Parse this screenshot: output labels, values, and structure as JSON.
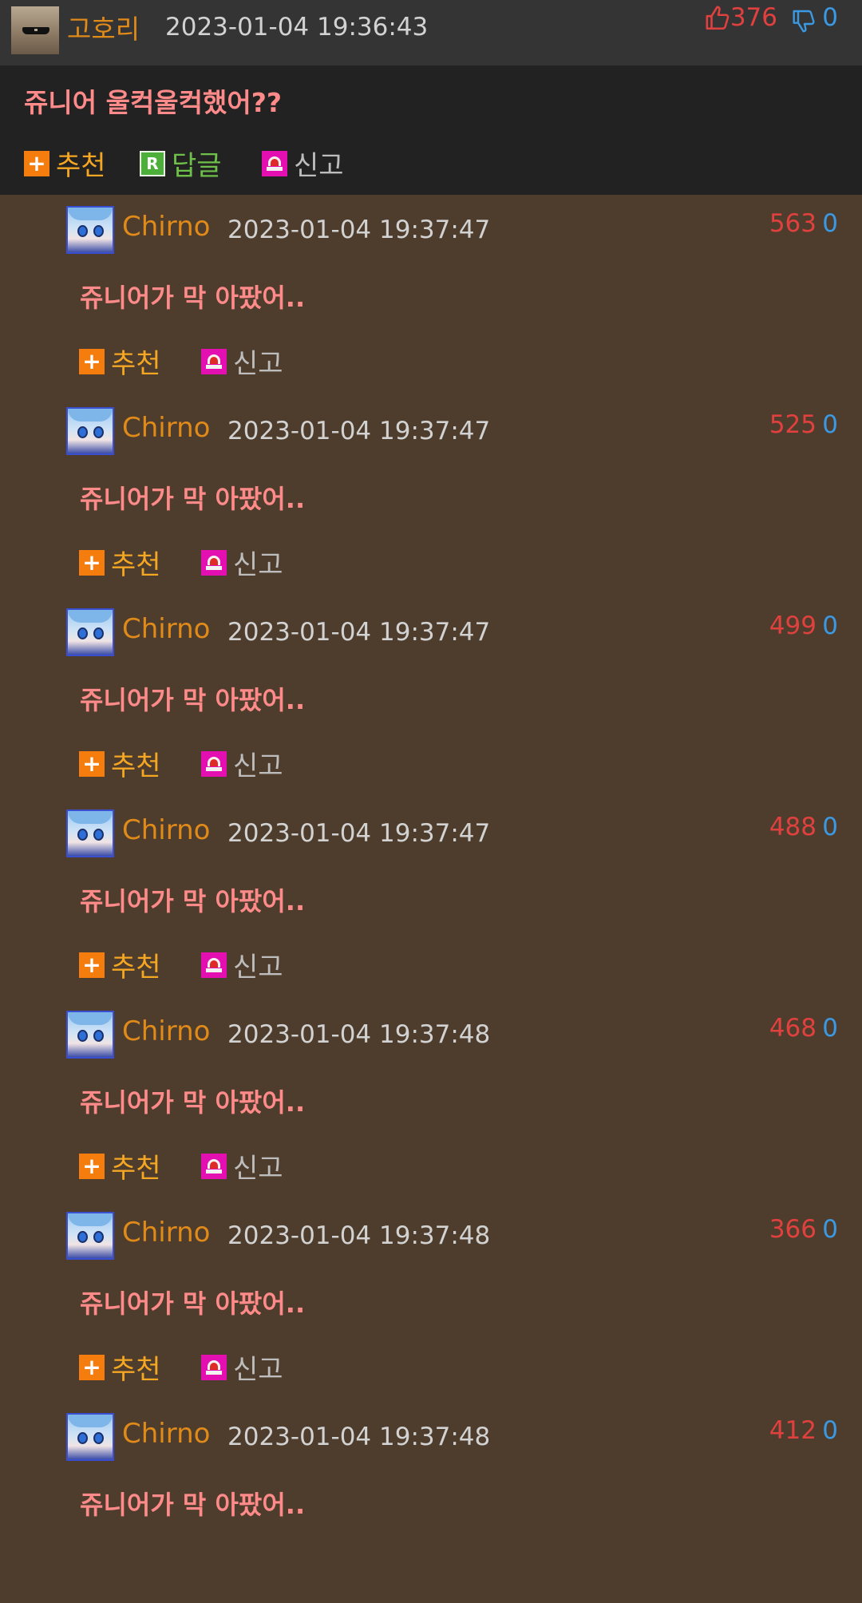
{
  "post": {
    "author": "고호리",
    "datetime": "2023-01-04 19:36:43",
    "upvotes": "376",
    "downvotes": "0",
    "title": "쥬니어 울컥울컥했어??",
    "actions": {
      "recommend": "추천",
      "reply": "답글",
      "report": "신고"
    },
    "icons": {
      "up": "thumbs-up-icon",
      "down": "thumbs-down-icon",
      "reply_badge": "R"
    }
  },
  "comments": [
    {
      "author": "Chirno",
      "datetime": "2023-01-04 19:37:47",
      "upvotes": "563",
      "downvotes": "0",
      "text": "쥬니어가 막 아팠어..",
      "recommend": "추천",
      "report": "신고"
    },
    {
      "author": "Chirno",
      "datetime": "2023-01-04 19:37:47",
      "upvotes": "525",
      "downvotes": "0",
      "text": "쥬니어가 막 아팠어..",
      "recommend": "추천",
      "report": "신고"
    },
    {
      "author": "Chirno",
      "datetime": "2023-01-04 19:37:47",
      "upvotes": "499",
      "downvotes": "0",
      "text": "쥬니어가 막 아팠어..",
      "recommend": "추천",
      "report": "신고"
    },
    {
      "author": "Chirno",
      "datetime": "2023-01-04 19:37:47",
      "upvotes": "488",
      "downvotes": "0",
      "text": "쥬니어가 막 아팠어..",
      "recommend": "추천",
      "report": "신고"
    },
    {
      "author": "Chirno",
      "datetime": "2023-01-04 19:37:48",
      "upvotes": "468",
      "downvotes": "0",
      "text": "쥬니어가 막 아팠어..",
      "recommend": "추천",
      "report": "신고"
    },
    {
      "author": "Chirno",
      "datetime": "2023-01-04 19:37:48",
      "upvotes": "366",
      "downvotes": "0",
      "text": "쥬니어가 막 아팠어..",
      "recommend": "추천",
      "report": "신고"
    },
    {
      "author": "Chirno",
      "datetime": "2023-01-04 19:37:48",
      "upvotes": "412",
      "downvotes": "0",
      "text": "쥬니어가 막 아팠어..",
      "recommend": "",
      "report": ""
    }
  ],
  "colors": {
    "background": "#4e3d2c",
    "header": "#343434",
    "title_area": "#222222",
    "author": "#e08a1a",
    "text_pink": "#ff8a8a",
    "upvote": "#e0413f",
    "downvote": "#3a99e2"
  }
}
